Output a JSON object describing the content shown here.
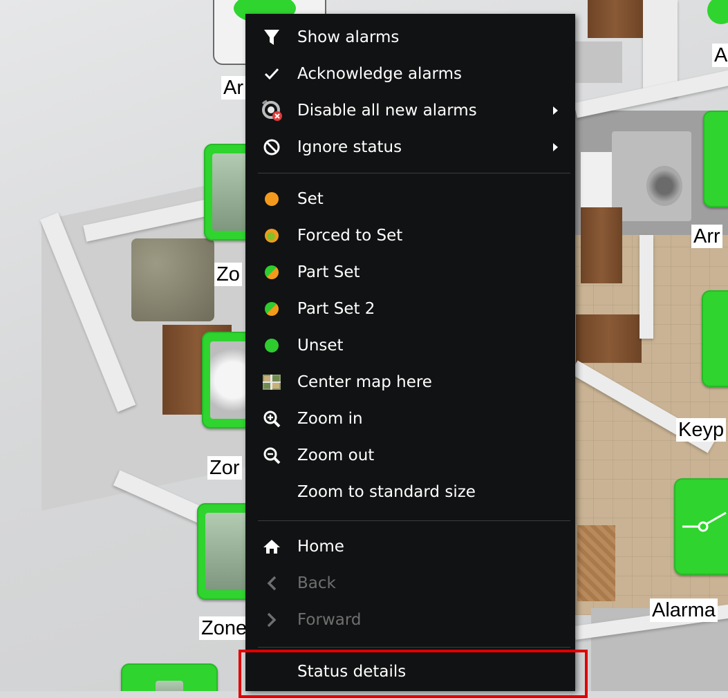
{
  "context_menu": {
    "items": [
      {
        "label": "Show alarms",
        "icon": "filter-icon"
      },
      {
        "label": "Acknowledge alarms",
        "icon": "checkmark-icon"
      },
      {
        "label": "Disable all new alarms",
        "icon": "disable-alarm-icon",
        "submenu": true
      },
      {
        "label": "Ignore status",
        "icon": "prohibited-icon",
        "submenu": true
      },
      {
        "label": "Set",
        "icon": "status-set-icon"
      },
      {
        "label": "Forced to Set",
        "icon": "status-forced-set-icon"
      },
      {
        "label": "Part Set",
        "icon": "status-part-set-icon"
      },
      {
        "label": "Part Set 2",
        "icon": "status-part-set-2-icon"
      },
      {
        "label": "Unset",
        "icon": "status-unset-icon"
      },
      {
        "label": "Center map here",
        "icon": "center-map-icon"
      },
      {
        "label": "Zoom in",
        "icon": "zoom-in-icon"
      },
      {
        "label": "Zoom out",
        "icon": "zoom-out-icon"
      },
      {
        "label": "Zoom to standard size",
        "icon": ""
      },
      {
        "label": "Home",
        "icon": "home-icon"
      },
      {
        "label": "Back",
        "icon": "chevron-left-icon",
        "disabled": true
      },
      {
        "label": "Forward",
        "icon": "chevron-right-icon",
        "disabled": true
      },
      {
        "label": "Status details",
        "icon": "",
        "highlighted": true
      }
    ]
  },
  "map_labels": {
    "ar_top": "Ar",
    "a_right_top": "A",
    "zo_1": "Zo",
    "arr_right": "Arr",
    "zor": "Zor",
    "keyp": "Keyp",
    "zone": "Zone",
    "alarma": "Alarma"
  },
  "colors": {
    "status_set": "#f39a1c",
    "status_unset": "#2ecc2e",
    "device_green": "#2fd42f",
    "menu_bg": "#111213",
    "highlight_red": "#e00000"
  }
}
